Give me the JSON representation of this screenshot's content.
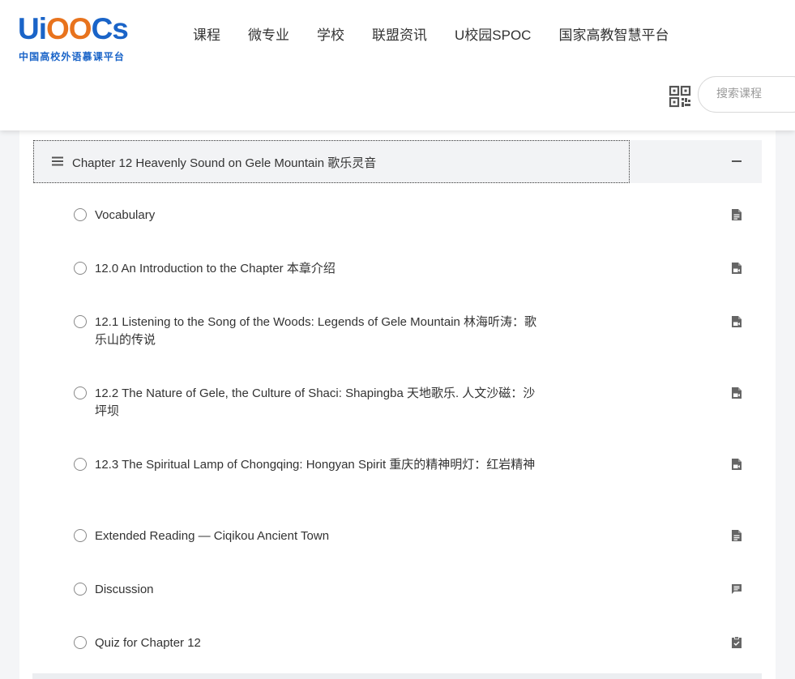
{
  "header": {
    "logo": {
      "main_u": "U",
      "main_i": "i",
      "main_oo": "OO",
      "main_rest": "Cs",
      "subtitle": "中国高校外语慕课平台"
    },
    "nav": [
      "课程",
      "微专业",
      "学校",
      "联盟资讯",
      "U校园SPOC",
      "国家高教智慧平台"
    ],
    "qr_icon": "qr-code-icon",
    "search": {
      "placeholder": "搜索课程",
      "value": ""
    }
  },
  "chapter": {
    "title": "Chapter 12 Heavenly Sound on Gele Mountain 歌乐灵音",
    "expanded": true,
    "icon": "menu-icon",
    "toggle_icon": "minus-icon"
  },
  "lessons": [
    {
      "title": "Vocabulary",
      "icon": "document-icon"
    },
    {
      "title": "12.0 An Introduction to the Chapter 本章介绍",
      "icon": "video-document-icon"
    },
    {
      "title": "12.1 Listening to the Song of the Woods: Legends of Gele Mountain 林海听涛：歌乐山的传说",
      "icon": "video-document-icon"
    },
    {
      "title": "12.2 The Nature of Gele, the Culture of Shaci: Shapingba 天地歌乐. 人文沙磁：沙坪坝",
      "icon": "video-document-icon"
    },
    {
      "title": "12.3 The Spiritual Lamp of Chongqing: Hongyan Spirit 重庆的精神明灯：红岩精神",
      "icon": "video-document-icon"
    },
    {
      "title": "Extended Reading — Ciqikou Ancient Town",
      "icon": "document-icon"
    },
    {
      "title": "Discussion",
      "icon": "chat-icon"
    },
    {
      "title": "Quiz for Chapter 12",
      "icon": "quiz-icon"
    }
  ],
  "colors": {
    "brand_blue": "#1a64c8",
    "brand_orange": "#e8731d",
    "icon_gray": "#666666"
  }
}
